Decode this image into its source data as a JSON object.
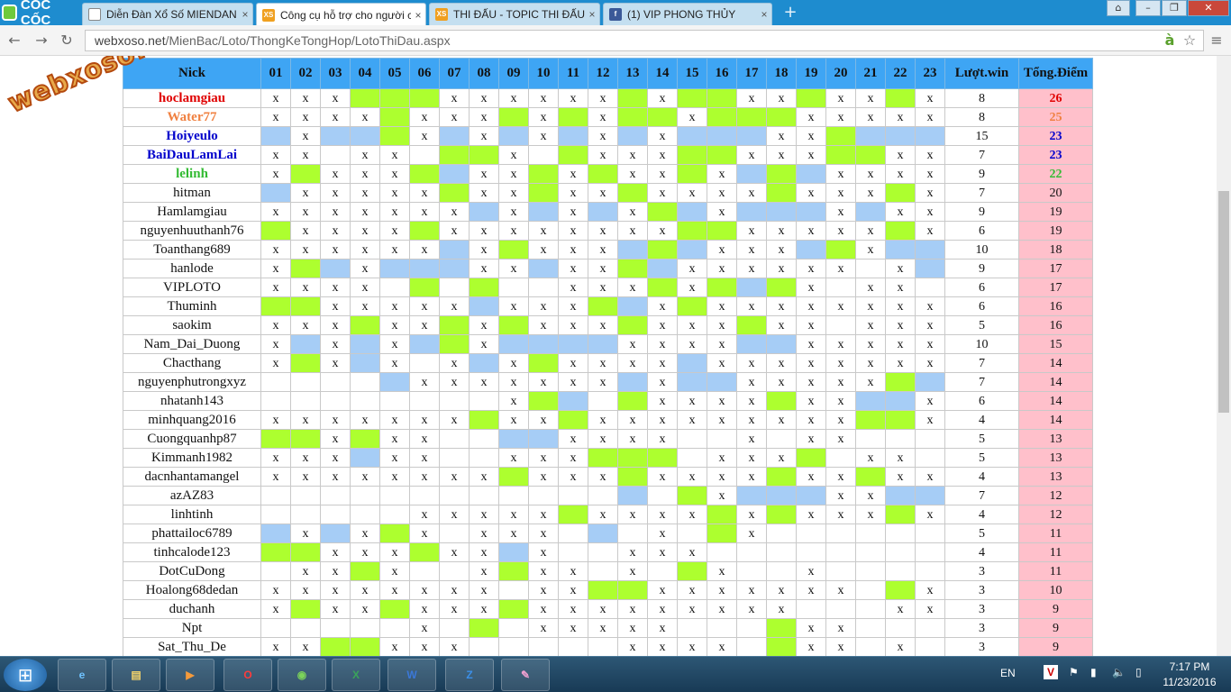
{
  "browser": {
    "brand": "CỐC CỐC",
    "url_host": "webxoso.net",
    "url_path": "/MienBac/Loto/ThongKeTongHop/LotoThiDau.aspx",
    "tabs": [
      {
        "title": "Diễn Đàn Xổ Số MIENDAN",
        "icon": "page-icon",
        "color": "#ffffff"
      },
      {
        "title": "Công cụ hỗ trợ cho người chơi",
        "icon": "xs-icon",
        "color": "#f0a020",
        "active": true
      },
      {
        "title": "THI ĐẤU - TOPIC THI ĐẤU",
        "icon": "xs-icon",
        "color": "#f0a020"
      },
      {
        "title": "(1) VIP PHONG THỦY",
        "icon": "facebook-icon",
        "color": "#3b5998"
      }
    ]
  },
  "watermark": "webxoso.net",
  "table": {
    "headers": [
      "Nick",
      "01",
      "02",
      "03",
      "04",
      "05",
      "06",
      "07",
      "08",
      "09",
      "10",
      "11",
      "12",
      "13",
      "14",
      "15",
      "16",
      "17",
      "18",
      "19",
      "20",
      "21",
      "22",
      "23",
      "Lượt.win",
      "Tổng.Điểm"
    ],
    "legend": {
      "x": "x",
      "g": "green highlight",
      "b": "blue highlight",
      "_": "empty"
    },
    "rows": [
      {
        "nick": "hoclamgiau",
        "color": "#e00000",
        "cells": "xxxgggxxxxxxgxggxxgxxgx",
        "win": "8",
        "total": "26"
      },
      {
        "nick": "Water77",
        "color": "#f08040",
        "cells": "xxxxgxxxgxgxggxgggxxxxx",
        "win": "8",
        "total": "25"
      },
      {
        "nick": "Hoiyeulo",
        "color": "#0000cc",
        "cells": "bxbbgxbxbxbxbxbbbxxgbbb",
        "win": "15",
        "total": "23"
      },
      {
        "nick": "BaiDauLamLai",
        "color": "#0000cc",
        "cells": "xx_xx_ggx_gxxxggxxxggxx",
        "win": "7",
        "total": "23"
      },
      {
        "nick": "lelinh",
        "color": "#33bb33",
        "cells": "xgxxxgbxxgxgxxgxbgbxxxx",
        "win": "9",
        "total": "22"
      },
      {
        "nick": "hitman",
        "color": "#111111",
        "cells": "bxxxxxgxxgxxgxxxxgxxxgx",
        "win": "7",
        "total": "20"
      },
      {
        "nick": "Hamlamgiau",
        "color": "#111111",
        "cells": "xxxxxxxbxbxbxgbxbbbxbxx",
        "win": "9",
        "total": "19"
      },
      {
        "nick": "nguyenhuuthanh76",
        "color": "#111111",
        "cells": "gxxxxgxxxxxxxxggxxxxxgx",
        "win": "6",
        "total": "19"
      },
      {
        "nick": "Toanthang689",
        "color": "#111111",
        "cells": "xxxxxxbxgxxxbgbxxxbgxbb",
        "win": "10",
        "total": "18"
      },
      {
        "nick": "hanlode",
        "color": "#111111",
        "cells": "xgbxbbbxxbxxgbxxxxxx_xb",
        "win": "9",
        "total": "17"
      },
      {
        "nick": "VIPLOTO",
        "color": "#111111",
        "cells": "xxxx_g_g__xxxgxgbgx_xx_",
        "win": "6",
        "total": "17"
      },
      {
        "nick": "Thuminh",
        "color": "#111111",
        "cells": "ggxxxxxbxxxgbxgxxxxxxxx",
        "win": "6",
        "total": "16"
      },
      {
        "nick": "saokim",
        "color": "#111111",
        "cells": "xxxgxxgxgxxxgxxxgxx_xxx",
        "win": "5",
        "total": "16"
      },
      {
        "nick": "Nam_Dai_Duong",
        "color": "#111111",
        "cells": "xbxbxbgxbbbbxxxxbbxxxxx",
        "win": "10",
        "total": "15"
      },
      {
        "nick": "Chacthang",
        "color": "#111111",
        "cells": "xgxbx_xbxgxxxxbxxxxxxxx",
        "win": "7",
        "total": "14"
      },
      {
        "nick": "nguyenphutrongxyz",
        "color": "#111111",
        "cells": "____bxxxxxxxbxbbxxxxxgb",
        "win": "7",
        "total": "14"
      },
      {
        "nick": "nhatanh143",
        "color": "#111111",
        "cells": "________xgb_gxxxxgxxbbx",
        "win": "6",
        "total": "14"
      },
      {
        "nick": "minhquang2016",
        "color": "#111111",
        "cells": "xxxxxxxgxxgxxxxxxxxxggx",
        "win": "4",
        "total": "14"
      },
      {
        "nick": "Cuongquanhp87",
        "color": "#111111",
        "cells": "ggxgxx__bbxxxx__x_xx___",
        "win": "5",
        "total": "13"
      },
      {
        "nick": "Kimmanh1982",
        "color": "#111111",
        "cells": "xxxbxx__xxxggg_xxxg_xx_",
        "win": "5",
        "total": "13"
      },
      {
        "nick": "dacnhantamangel",
        "color": "#111111",
        "cells": "xxxxxxxxgxxxgxxxxgxxgxx",
        "win": "4",
        "total": "13"
      },
      {
        "nick": "azAZ83",
        "color": "#111111",
        "cells": "____________b_gxbbbxxbb",
        "win": "7",
        "total": "12"
      },
      {
        "nick": "linhtinh",
        "color": "#111111",
        "cells": "_____xxxxxgxxxxgxgxxxgx",
        "win": "4",
        "total": "12"
      },
      {
        "nick": "phattailoc6789",
        "color": "#111111",
        "cells": "bxbxgx_xxx_b_x_gx______",
        "win": "5",
        "total": "11"
      },
      {
        "nick": "tinhcalode123",
        "color": "#111111",
        "cells": "ggxxxgxxbx__xxx________",
        "win": "4",
        "total": "11"
      },
      {
        "nick": "DotCuDong",
        "color": "#111111",
        "cells": "_xxgx__xgxx_x_gx__x____",
        "win": "3",
        "total": "11"
      },
      {
        "nick": "Hoalong68dedan",
        "color": "#111111",
        "cells": "xxxxxxxx_xxggxxxxxxx_gx",
        "win": "3",
        "total": "10"
      },
      {
        "nick": "duchanh",
        "color": "#111111",
        "cells": "xgxxgxxxgxxxxxxxxx___xx",
        "win": "3",
        "total": "9"
      },
      {
        "nick": "Npt",
        "color": "#111111",
        "cells": "_____x_g_xxxxx___gxx___",
        "win": "3",
        "total": "9"
      },
      {
        "nick": "Sat_Thu_De",
        "color": "#111111",
        "cells": "xxggxxx_____xxxx_gxx_x_",
        "win": "3",
        "total": "9"
      }
    ]
  },
  "taskbar": {
    "lang": "EN",
    "time": "7:17 PM",
    "date": "11/23/2016",
    "apps": [
      "Internet Explorer",
      "File Explorer",
      "Media Player",
      "Opera",
      "Coc Coc",
      "Excel",
      "Word",
      "Zalo",
      "Paint"
    ]
  }
}
